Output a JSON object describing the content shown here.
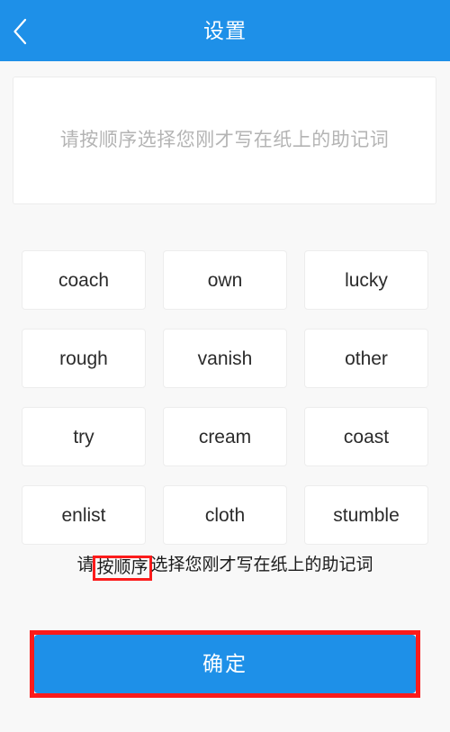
{
  "header": {
    "title": "设置",
    "back_icon": "chevron-left-icon",
    "background_color": "#1e90e8",
    "title_color": "#ffffff"
  },
  "mnemonic_input": {
    "placeholder": "请按顺序选择您刚才写在纸上的助记词",
    "value": "",
    "placeholder_color": "#b4b4b4"
  },
  "word_bank": {
    "words": [
      "coach",
      "own",
      "lucky",
      "rough",
      "vanish",
      "other",
      "try",
      "cream",
      "coast",
      "enlist",
      "cloth",
      "stumble"
    ]
  },
  "hint": {
    "prefix": "请",
    "highlighted": "按顺序",
    "suffix": "选择您刚才写在纸上的助记词",
    "full_text": "请按顺序选择您刚才写在纸上的助记词",
    "highlight_color": "#fc1b1b"
  },
  "confirm": {
    "label": "确定",
    "background_color": "#1e90e8",
    "annotation_color": "#fc1b1b"
  },
  "page": {
    "background_color": "#f8f8f8"
  }
}
